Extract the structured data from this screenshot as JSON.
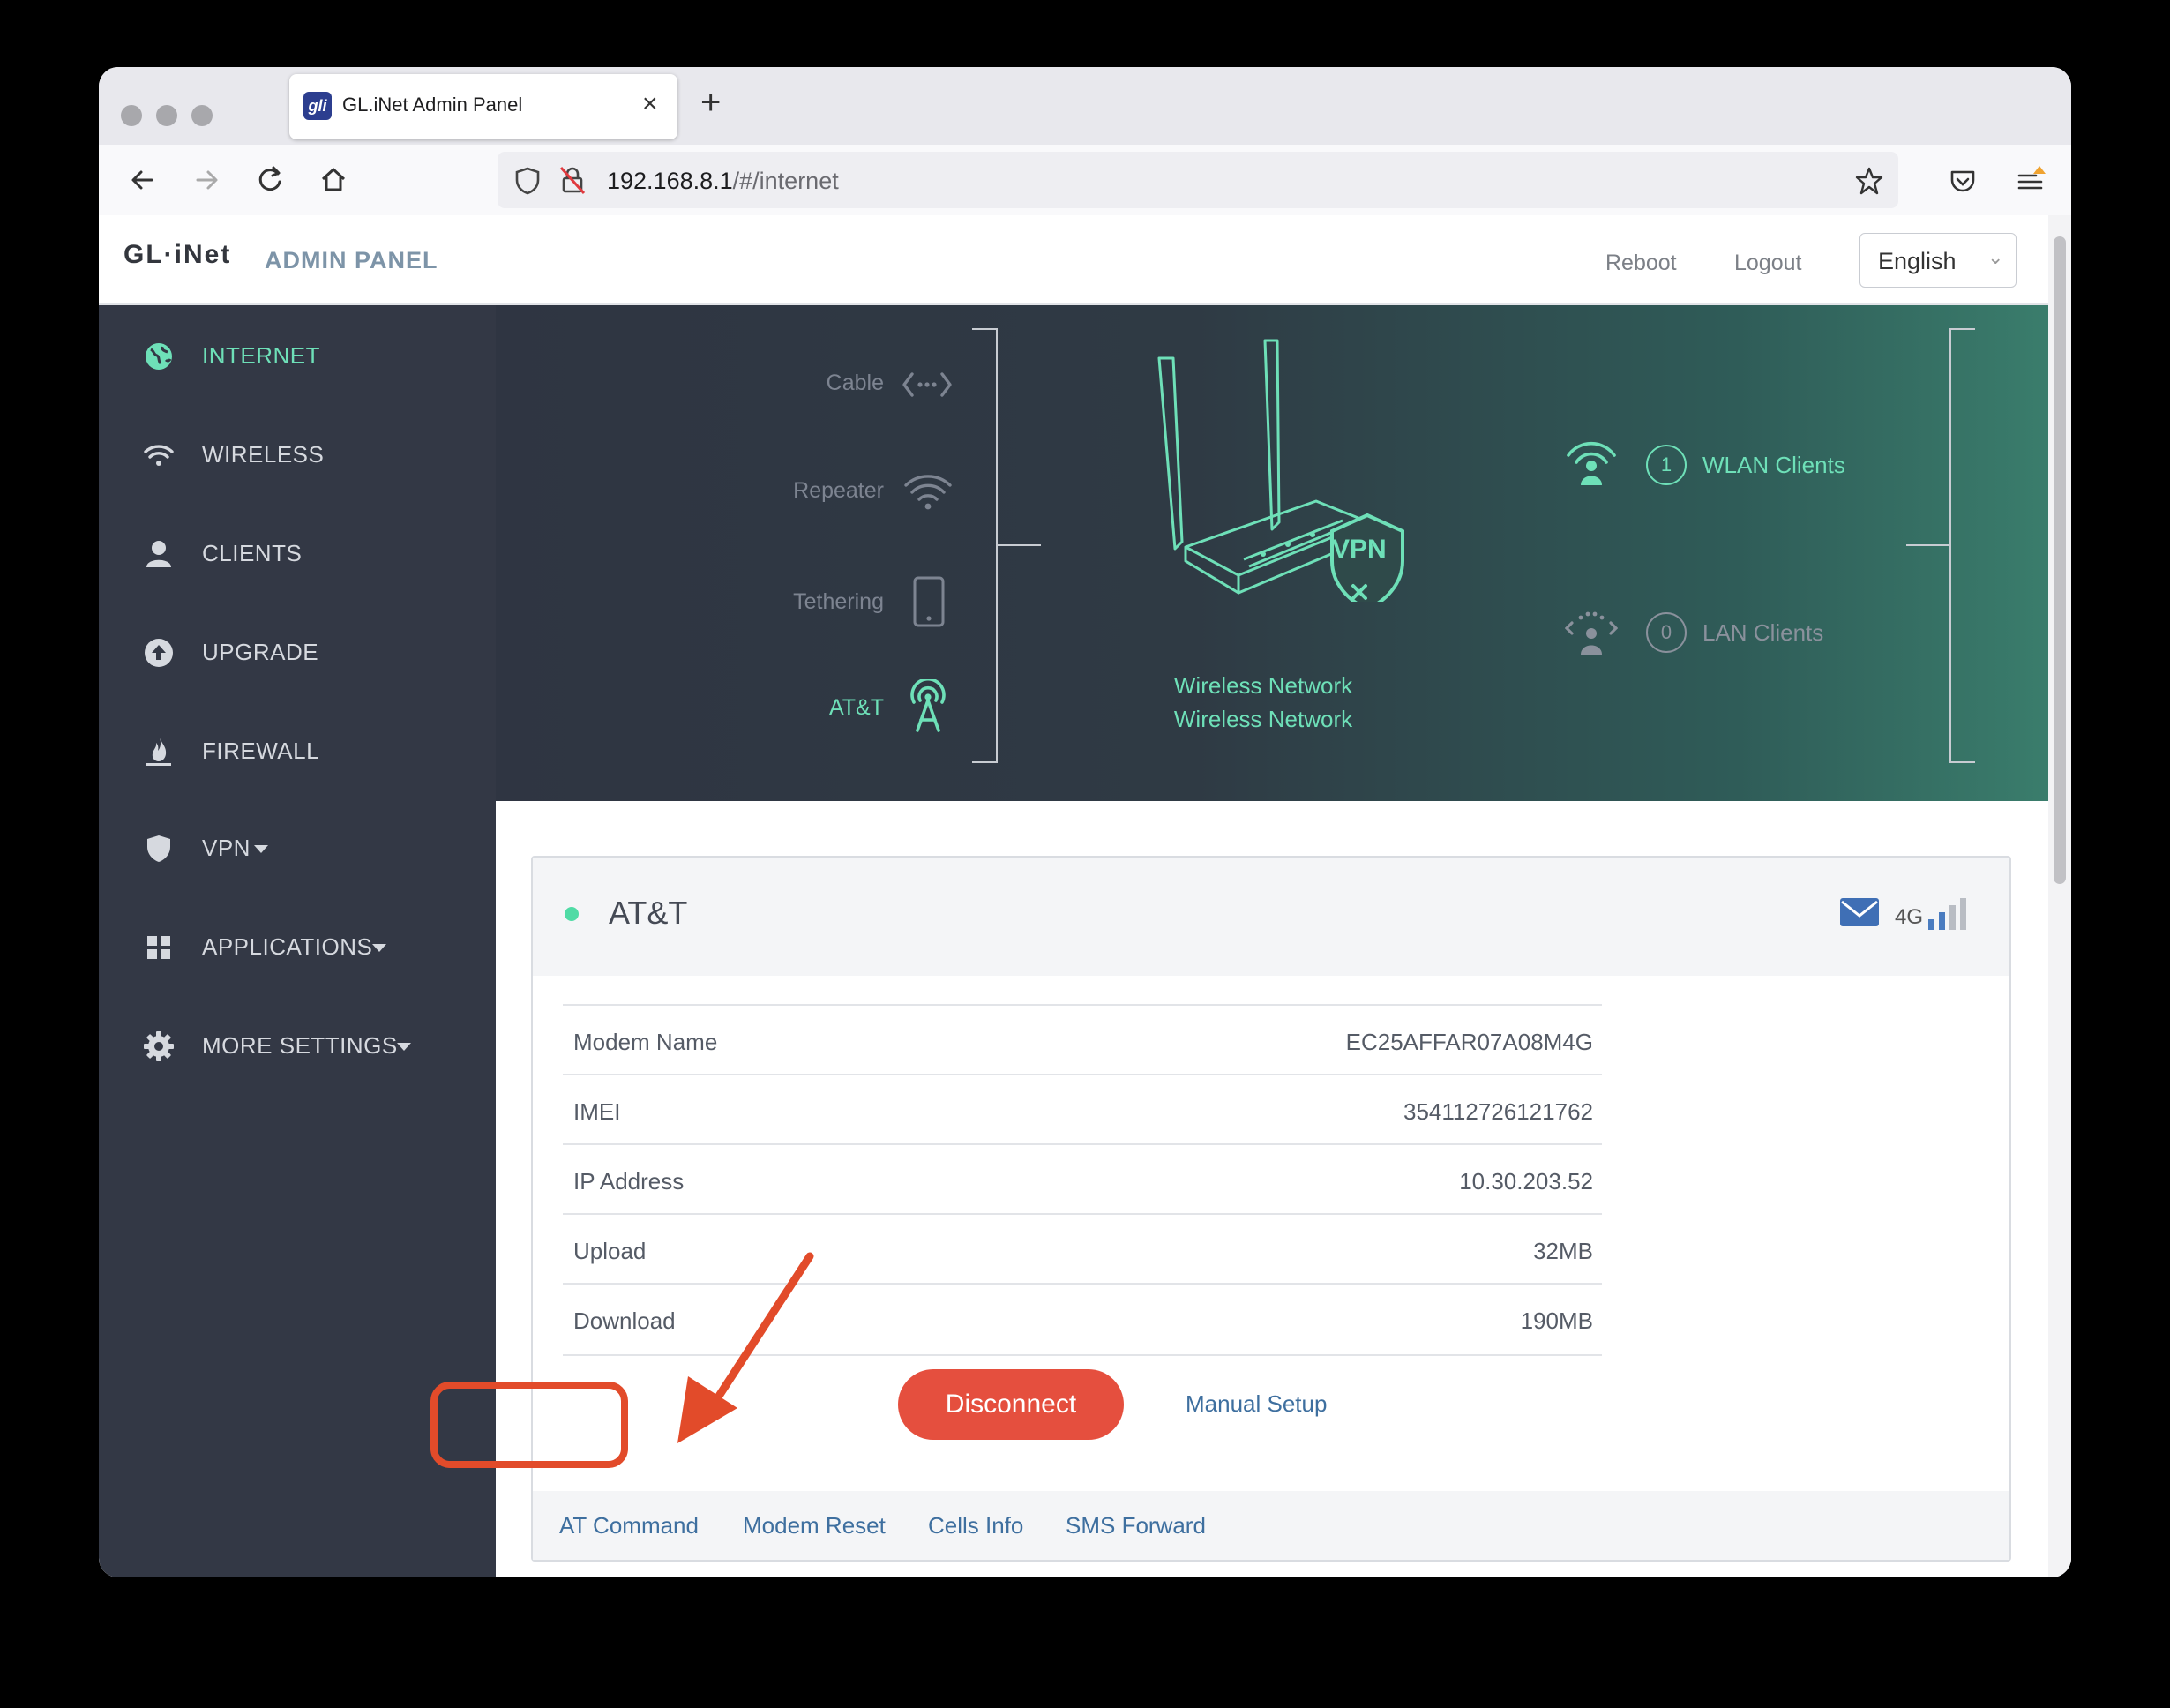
{
  "browser": {
    "tab_title": "GL.iNet Admin Panel",
    "tab_favicon": "gli",
    "tab_close": "×",
    "new_tab": "+",
    "url_host": "192.168.8.1",
    "url_path": "/#/internet"
  },
  "header": {
    "logo": "GL·iNet",
    "title": "ADMIN PANEL",
    "reboot": "Reboot",
    "logout": "Logout",
    "language": "English"
  },
  "sidebar": {
    "items": [
      {
        "label": "INTERNET",
        "icon": "globe-icon"
      },
      {
        "label": "WIRELESS",
        "icon": "wifi-icon"
      },
      {
        "label": "CLIENTS",
        "icon": "user-icon"
      },
      {
        "label": "UPGRADE",
        "icon": "upload-icon"
      },
      {
        "label": "FIREWALL",
        "icon": "flame-icon"
      },
      {
        "label": "VPN",
        "icon": "shield-icon"
      },
      {
        "label": "APPLICATIONS",
        "icon": "grid-icon"
      },
      {
        "label": "MORE SETTINGS",
        "icon": "gear-icon"
      }
    ]
  },
  "banner": {
    "sources": [
      "Cable",
      "Repeater",
      "Tethering",
      "AT&T"
    ],
    "center_line1": "Wireless Network",
    "center_line2": "Wireless Network",
    "vpn_badge": "VPN",
    "wlan_count": "1",
    "wlan_label": "WLAN Clients",
    "lan_count": "0",
    "lan_label": "LAN Clients"
  },
  "card": {
    "title": "AT&T",
    "network_type": "4G",
    "signal_bars": 2,
    "rows": [
      {
        "key": "Modem Name",
        "value": "EC25AFFAR07A08M4G"
      },
      {
        "key": "IMEI",
        "value": "354112726121762"
      },
      {
        "key": "IP Address",
        "value": "10.30.203.52"
      },
      {
        "key": "Upload",
        "value": "32MB"
      },
      {
        "key": "Download",
        "value": "190MB"
      }
    ],
    "disconnect": "Disconnect",
    "manual_setup": "Manual Setup",
    "footer_links": [
      "AT Command",
      "Modem Reset",
      "Cells Info",
      "SMS Forward"
    ]
  },
  "colors": {
    "accent": "#6ee0b8",
    "sidebar_bg": "#333845",
    "disconnect": "#e54f3e",
    "link": "#3e6f9f",
    "annotation": "#e24b2a"
  }
}
